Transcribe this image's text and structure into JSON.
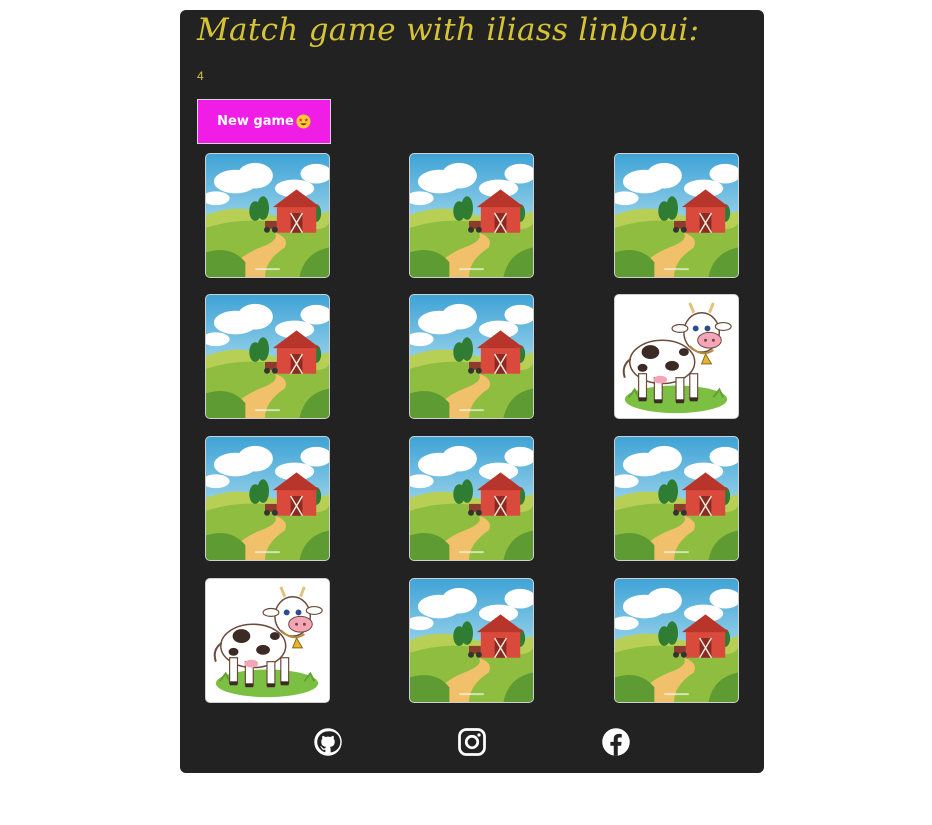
{
  "title": "Match game with iliass linboui:",
  "score": "4",
  "new_game_label": "New game",
  "new_game_emoji": "star-struck-emoji",
  "colors": {
    "panel": "#222222",
    "title": "#d6c235",
    "button": "#f01de6"
  },
  "cards": [
    {
      "state": "face-down",
      "image": "farm-barn-landscape"
    },
    {
      "state": "face-down",
      "image": "farm-barn-landscape"
    },
    {
      "state": "face-down",
      "image": "farm-barn-landscape"
    },
    {
      "state": "face-down",
      "image": "farm-barn-landscape"
    },
    {
      "state": "face-down",
      "image": "farm-barn-landscape"
    },
    {
      "state": "face-up",
      "image": "cow"
    },
    {
      "state": "face-down",
      "image": "farm-barn-landscape"
    },
    {
      "state": "face-down",
      "image": "farm-barn-landscape"
    },
    {
      "state": "face-down",
      "image": "farm-barn-landscape"
    },
    {
      "state": "face-up",
      "image": "cow"
    },
    {
      "state": "face-down",
      "image": "farm-barn-landscape"
    },
    {
      "state": "face-down",
      "image": "farm-barn-landscape"
    }
  ],
  "social_links": [
    {
      "icon": "github-icon"
    },
    {
      "icon": "instagram-icon"
    },
    {
      "icon": "facebook-icon"
    }
  ]
}
